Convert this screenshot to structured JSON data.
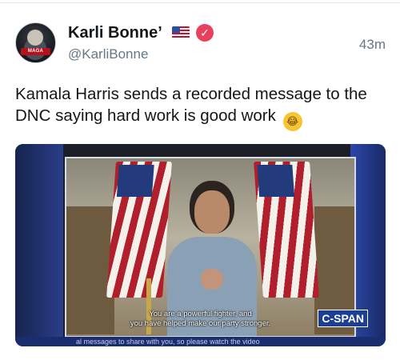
{
  "author": {
    "display_name": "Karli Bonne’",
    "handle": "@KarliBonne",
    "avatar_text": "MAGA"
  },
  "timestamp": "43m",
  "tweet": {
    "text": "Kamala Harris sends a recorded message to the DNC saying hard work is good work",
    "emoji": "rolling-on-floor-laughing"
  },
  "media": {
    "caption_line1": "You are a powerful fighter, and",
    "caption_line2": "you have helped make our party stronger.",
    "network_logo": "C-SPAN",
    "ticker_text": "al messages to share with you, so please watch the video"
  },
  "colors": {
    "verified_badge": "#e8405f",
    "text_secondary": "#657786",
    "cspan_blue": "#1c3f94"
  }
}
